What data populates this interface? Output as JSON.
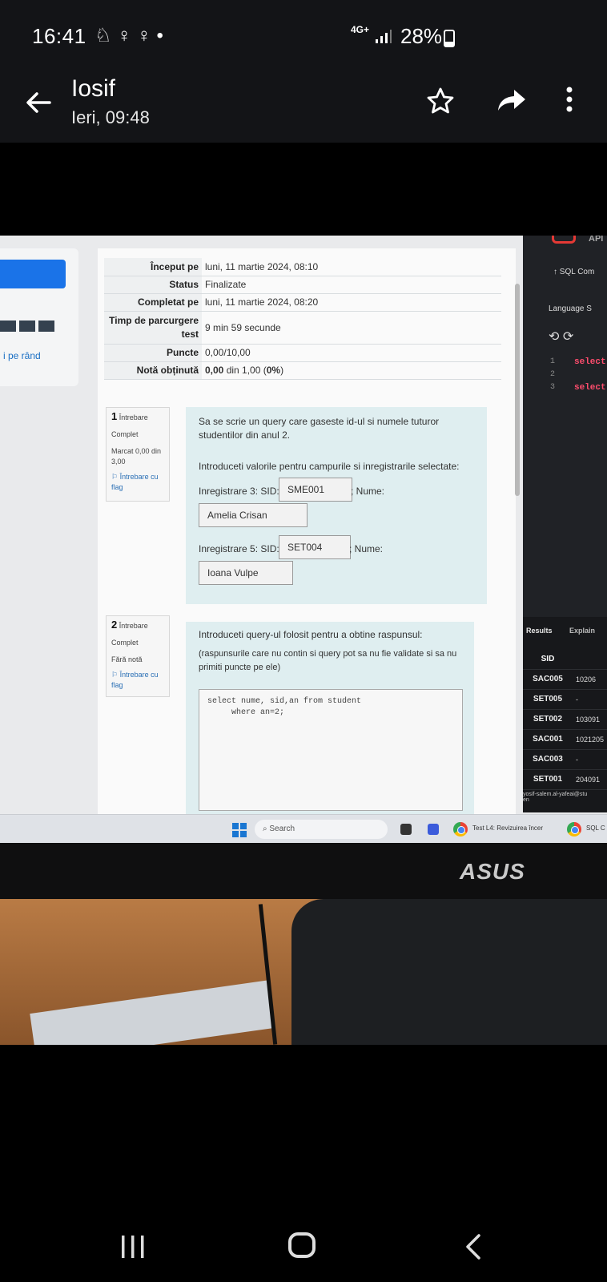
{
  "status_bar": {
    "time": "16:41",
    "left_icons": "♘ ♀ ♀ •",
    "network_label": "4G+",
    "battery_percent": "28%"
  },
  "app_bar": {
    "title": "Iosif",
    "subtitle": "Ieri, 09:48"
  },
  "screen": {
    "sidebar": {
      "link_text": "i pe rând"
    },
    "summary": [
      {
        "label": "Început pe",
        "value": "luni, 11 martie 2024, 08:10"
      },
      {
        "label": "Status",
        "value": "Finalizate"
      },
      {
        "label": "Completat pe",
        "value": "luni, 11 martie 2024, 08:20"
      },
      {
        "label": "Timp de parcurgere test",
        "value": "9 min 59 secunde"
      },
      {
        "label": "Puncte",
        "value": "0,00/10,00"
      },
      {
        "label": "Notă obținută",
        "value_bold": "0,00",
        "value_mid": " din 1,00 (",
        "value_pct": "0%",
        "value_end": ")"
      }
    ],
    "q1": {
      "number": "1",
      "label": "Întrebare",
      "state": "Complet",
      "mark": "Marcat 0,00 din 3,00",
      "flag": "Întrebare cu flag",
      "text1": "Sa se scrie un query care gaseste id-ul si numele tuturor studentilor din anul 2.",
      "text2": "Introduceti valorile pentru campurile si inregistrarile selectate:",
      "row3_label": "Inregistrare 3: SID:",
      "row3_sid": "SME001",
      "row3_name_label": "; Nume:",
      "row3_name": "Amelia Crisan",
      "row5_label": "Inregistrare 5: SID:",
      "row5_sid": "SET004",
      "row5_name_label": "; Nume:",
      "row5_name": "Ioana Vulpe"
    },
    "q2": {
      "number": "2",
      "label": "Întrebare",
      "state": "Complet",
      "mark": "Fără notă",
      "flag": "Întrebare cu flag",
      "text1": "Introduceti query-ul folosit pentru a obtine raspunsul:",
      "text2": "(raspunsurile care nu contin si query pot sa nu fie validate si sa nu primiti puncte pe ele)",
      "code": "select nume, sid,an from student\n     where an=2;"
    },
    "right_panel": {
      "api": "API",
      "sql_label": "↑  SQL Com",
      "language": "Language   S",
      "lines": [
        "1",
        "2",
        "3"
      ],
      "code_lines": [
        "select",
        "",
        "select"
      ],
      "tab_results": "Results",
      "tab_explain": "Explain",
      "header": "SID",
      "rows": [
        {
          "sid": "SAC005",
          "num": "10206"
        },
        {
          "sid": "SET005",
          "num": "-"
        },
        {
          "sid": "SET002",
          "num": "103091"
        },
        {
          "sid": "SAC001",
          "num": "1021205"
        },
        {
          "sid": "SAC003",
          "num": "-"
        },
        {
          "sid": "SET001",
          "num": "204091"
        }
      ],
      "user": "yosif-salem.al-yafeai@stu",
      "lang_code": "en"
    },
    "taskbar": {
      "search": "Search",
      "tab1": "Test L4: Revizuirea încer",
      "tab2": "SQL C"
    },
    "monitor_brand": "ASUS"
  }
}
